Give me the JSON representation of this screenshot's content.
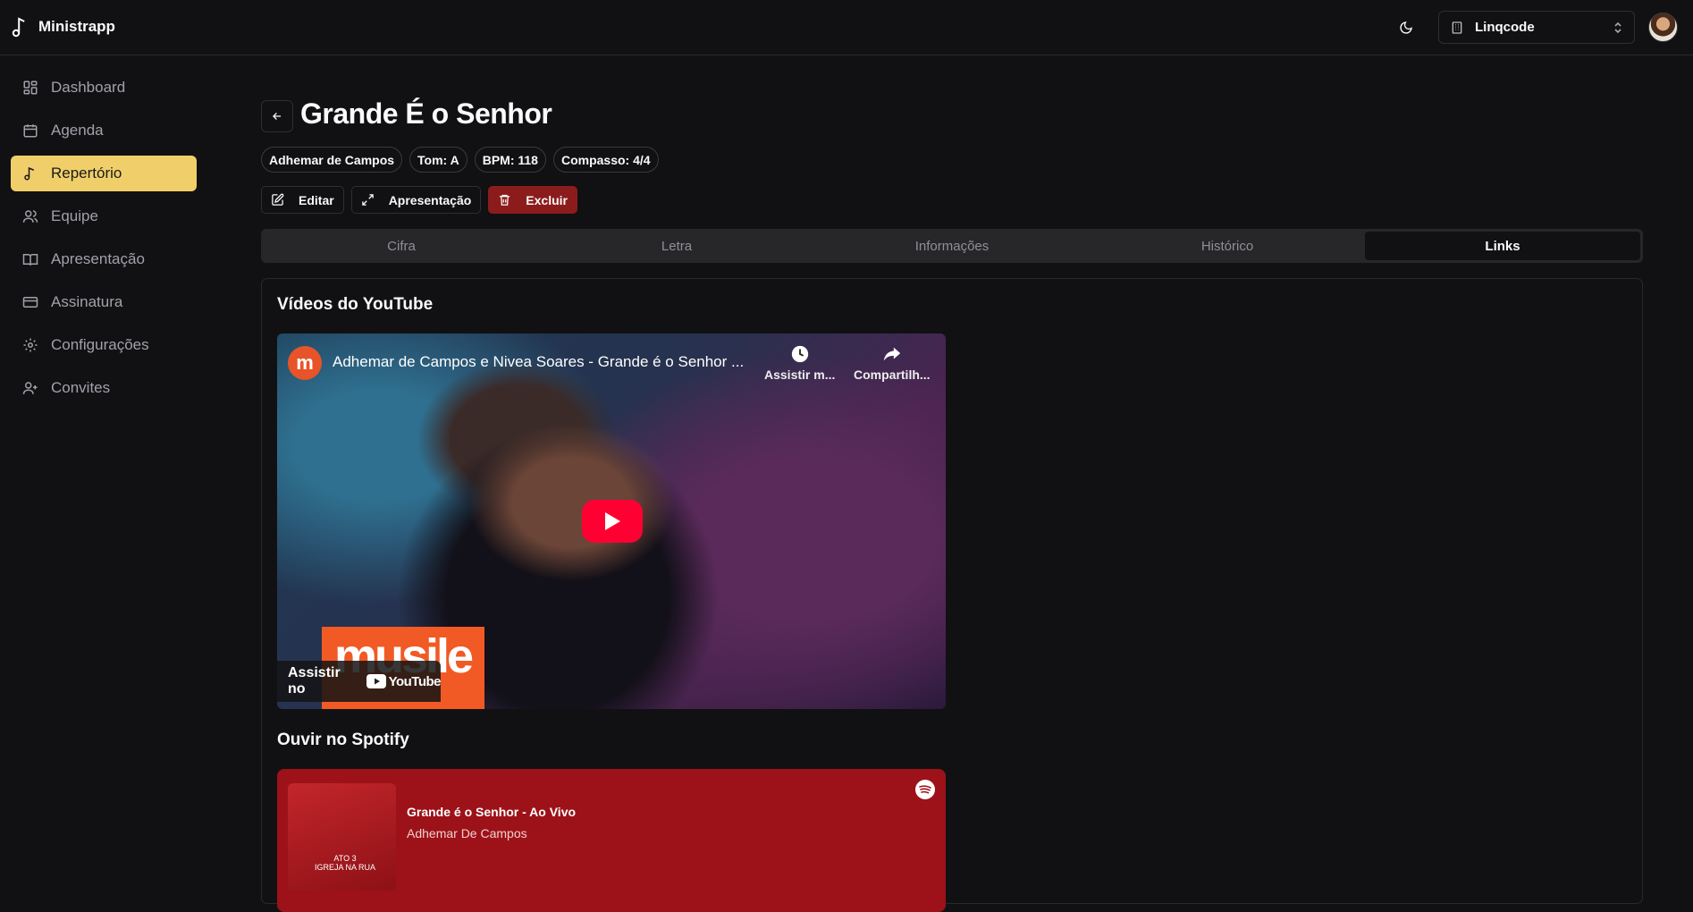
{
  "app": {
    "name": "Ministrapp"
  },
  "header": {
    "org_name": "Linqcode"
  },
  "sidebar": {
    "items": [
      {
        "label": "Dashboard"
      },
      {
        "label": "Agenda"
      },
      {
        "label": "Repertório",
        "active": true
      },
      {
        "label": "Equipe"
      },
      {
        "label": "Apresentação"
      },
      {
        "label": "Assinatura"
      },
      {
        "label": "Configurações"
      },
      {
        "label": "Convites"
      }
    ]
  },
  "song": {
    "title": "Grande É o Senhor",
    "badges": [
      "Adhemar de Campos",
      "Tom: A",
      "BPM: 118",
      "Compasso: 4/4"
    ]
  },
  "actions": {
    "edit": "Editar",
    "present": "Apresentação",
    "delete": "Excluir"
  },
  "tabs": [
    {
      "label": "Cifra"
    },
    {
      "label": "Letra"
    },
    {
      "label": "Informações"
    },
    {
      "label": "Histórico"
    },
    {
      "label": "Links",
      "active": true
    }
  ],
  "links": {
    "youtube_heading": "Vídeos do YouTube",
    "video": {
      "channel_logo": "m",
      "title": "Adhemar de Campos e Nivea Soares - Grande é o Senhor ...",
      "watch_later": "Assistir m...",
      "share": "Compartilh...",
      "brand_overlay": "musile",
      "watch_on": "Assistir no",
      "youtube": "YouTube"
    },
    "spotify_heading": "Ouvir no Spotify",
    "spotify": {
      "track": "Grande é o Senhor - Ao Vivo",
      "artist": "Adhemar De Campos",
      "cover_text": "ATO 3\nIGREJA NA RUA"
    }
  },
  "colors": {
    "accent": "#f0cf6a",
    "danger": "#8c1c1c",
    "spotify_bg": "#9c1218",
    "youtube_red": "#ff0033"
  }
}
